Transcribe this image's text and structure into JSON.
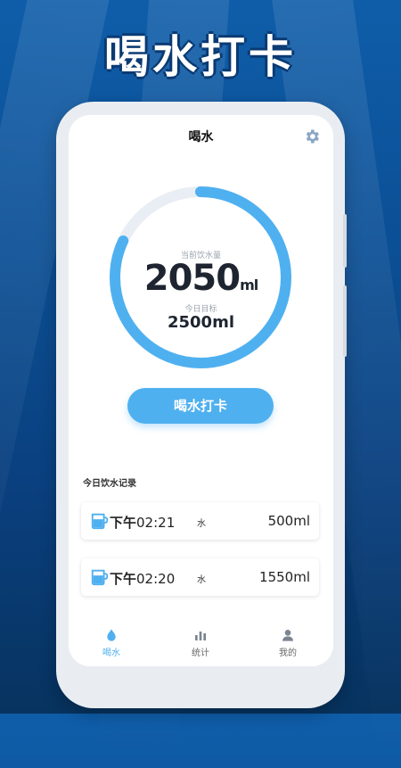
{
  "promo": {
    "headline": "喝水打卡"
  },
  "app": {
    "title": "喝水"
  },
  "progress": {
    "current_label": "当前饮水量",
    "current_value": "2050",
    "current_unit": "ml",
    "target_label": "今日目标",
    "target_value": "2500ml",
    "fraction": 0.82
  },
  "checkin": {
    "label": "喝水打卡"
  },
  "records": {
    "title": "今日饮水记录",
    "items": [
      {
        "period": "下午",
        "time": "02:21",
        "type": "水",
        "amount": "500ml"
      },
      {
        "period": "下午",
        "time": "02:20",
        "type": "水",
        "amount": "1550ml"
      }
    ]
  },
  "tabs": [
    {
      "label": "喝水",
      "icon": "water-drop-icon",
      "active": true
    },
    {
      "label": "统计",
      "icon": "bar-chart-icon",
      "active": false
    },
    {
      "label": "我的",
      "icon": "user-icon",
      "active": false
    }
  ],
  "colors": {
    "accent": "#4fb0f0",
    "ring_track": "#e9eef5",
    "inactive": "#666666"
  }
}
